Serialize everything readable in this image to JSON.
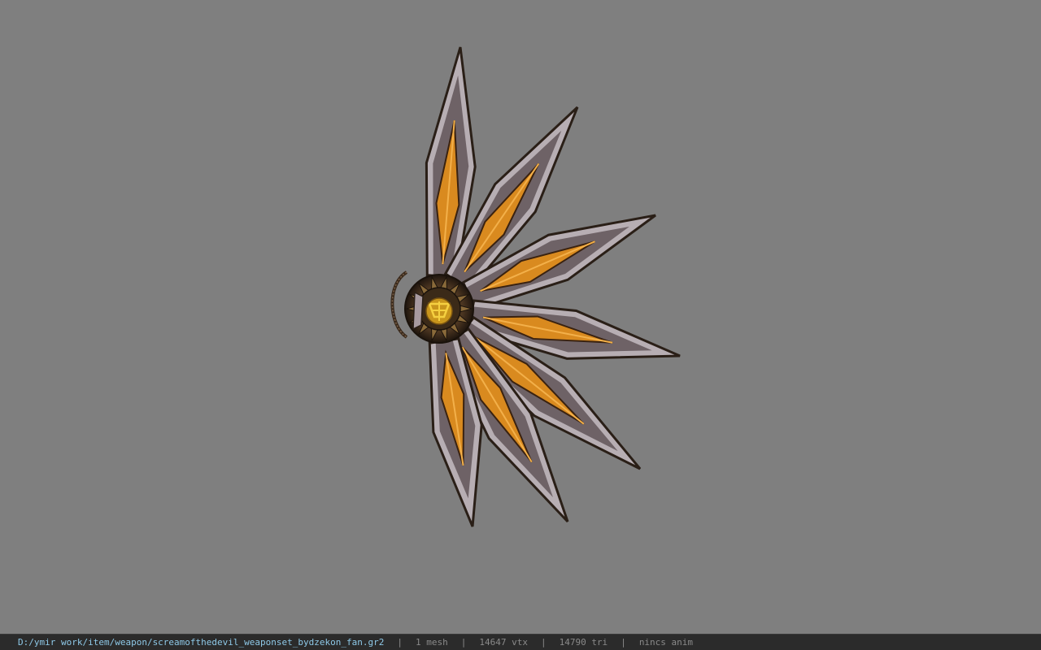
{
  "viewer": {
    "model_name": "battle fan weapon model",
    "background_color": "#7f7f7f"
  },
  "status": {
    "file_path": "D:/ymir work/item/weapon/screamofthedevil_weaponset_bydzekon_fan.gr2",
    "separator": "|",
    "mesh": "1 mesh",
    "vertices": "14647 vtx",
    "triangles": "14790 tri",
    "anim": "nincs anim"
  },
  "colors": {
    "statusbar_bg": "#2b2b2b",
    "path_text": "#8ec9e8",
    "info_text": "#8a8a8a",
    "blade_orange": "#d98a1f",
    "blade_metal": "#b9b3b8",
    "blade_dark": "#2a1f17",
    "emblem_gold": "#e0b020"
  }
}
